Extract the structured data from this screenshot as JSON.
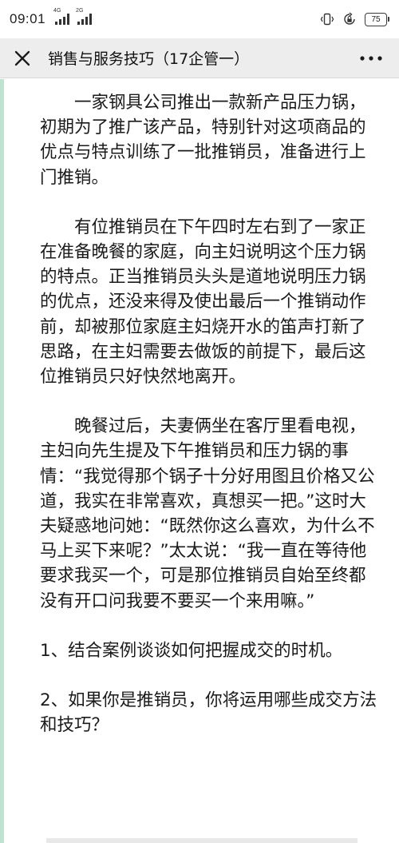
{
  "status_bar": {
    "time": "09:01",
    "signal1_tag": "4G",
    "signal2_tag": "2G",
    "battery": "75",
    "icons": [
      "signal-icon",
      "signal-icon",
      "vibrate-icon",
      "rotation-lock-icon",
      "battery-icon"
    ]
  },
  "title_bar": {
    "title": "销售与服务技巧（17企管一）",
    "icons": [
      "close-icon",
      "more-icon"
    ]
  },
  "article": {
    "paragraphs": [
      "一家钢具公司推出一款新产品压力锅，初期为了推广该产品，特别针对这项商品的优点与特点训练了一批推销员，准备进行上门推销。",
      "有位推销员在下午四时左右到了一家正在准备晚餐的家庭，向主妇说明这个压力锅的特点。正当推销员头头是道地说明压力锅的优点，还没来得及使出最后一个推销动作前，却被那位家庭主妇烧开水的笛声打新了思路，在主妇需要去做饭的前提下，最后这位推销员只好快然地离开。",
      "晚餐过后，夫妻俩坐在客厅里看电视，主妇向先生提及下午推销员和压力锅的事情：“我觉得那个锅子十分好用图且价格又公道，我实在非常喜欢，真想买一把。”这时大夫疑惑地问她：“既然你这么喜欢，为什么不马上买下来呢？”太太说：“我一直在等待他要求我买一个，可是那位推销员自始至终都没有开口问我要不要买一个来用嘛。”"
    ],
    "questions": [
      "1、结合案例谈谈如何把握成交的时机。",
      "2、如果你是推销员，你将运用哪些成交方法和技巧？"
    ]
  },
  "colors": {
    "accent_border": "#bfe3d0",
    "title_bar_bg": "#ededed"
  }
}
